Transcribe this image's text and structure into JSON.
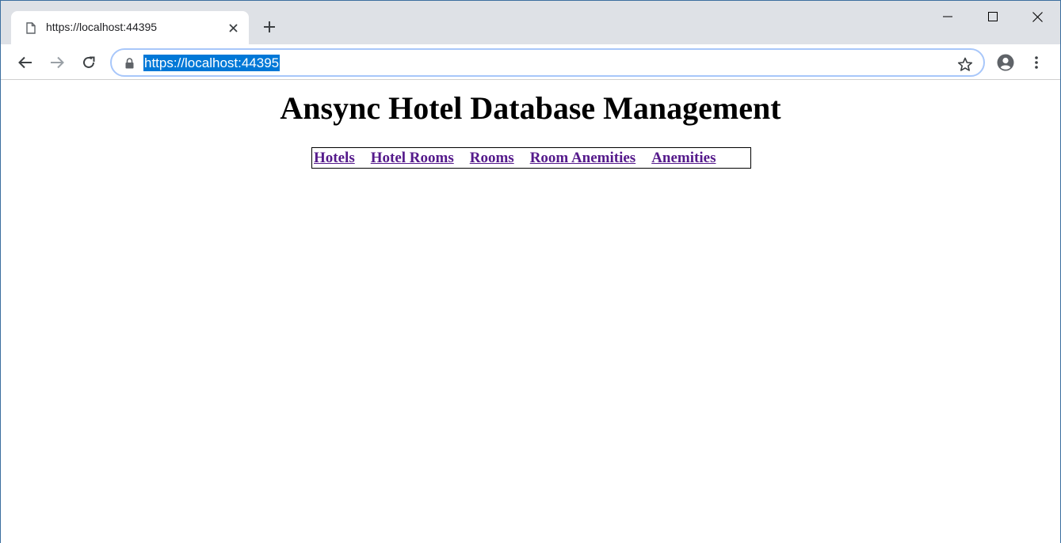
{
  "browser": {
    "tab": {
      "title": "https://localhost:44395"
    },
    "address_bar": {
      "url": "https://localhost:44395"
    },
    "icons": {
      "favicon": "page-icon",
      "tab_close": "close-icon",
      "new_tab": "plus-icon",
      "minimize": "minimize-icon",
      "maximize": "maximize-icon",
      "close": "close-icon",
      "back": "arrow-left-icon",
      "forward": "arrow-right-icon",
      "reload": "reload-icon",
      "lock": "lock-icon",
      "bookmark": "star-icon",
      "profile": "account-icon",
      "menu": "kebab-menu-icon"
    },
    "colors": {
      "tabstrip": "#dee1e6",
      "url_selection": "#0078d7",
      "omnibox_focus": "#a8c7fa"
    }
  },
  "page": {
    "title": "Ansync Hotel Database Management",
    "nav": [
      {
        "label": "Hotels"
      },
      {
        "label": "Hotel Rooms"
      },
      {
        "label": "Rooms"
      },
      {
        "label": "Room Anemities"
      },
      {
        "label": "Anemities"
      }
    ],
    "colors": {
      "visited_link": "#551a8b",
      "text": "#000000"
    }
  }
}
